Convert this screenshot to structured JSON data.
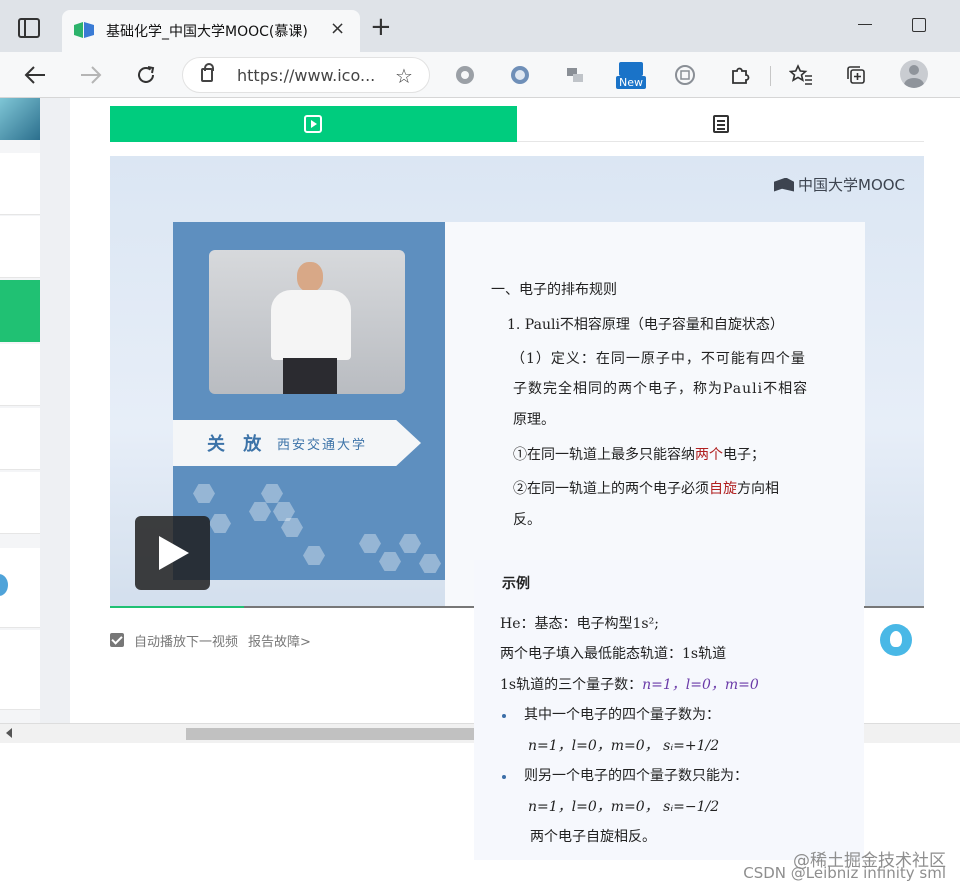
{
  "browser": {
    "tab_title": "基础化学_中国大学MOOC(慕课)",
    "tab_close": "×",
    "new_tab": "+",
    "address_text": "https://www.ico...",
    "new_badge": "New"
  },
  "course_page": {
    "video_logo": "中国大学MOOC",
    "lecturer_name": "关 放",
    "lecturer_school": "西安交通大学",
    "slide": {
      "heading": "一、电子的排布规则",
      "principle": "1. Pauli不相容原理（电子容量和自旋状态）",
      "def_line1": "（1）定义：在同一原子中，不可能有四个量",
      "def_line2": "子数完全相同的两个电子，称为Pauli不相容",
      "def_line3": "原理。",
      "point1_pre": "①在同一轨道上最多只能容纳",
      "point1_red": "两个",
      "point1_post": "电子；",
      "point2_pre": "②在同一轨道上的两个电子必须",
      "point2_red": "自旋",
      "point2_post": "方向相",
      "point2_line2": "反。"
    },
    "autoplay_label": "自动播放下一视频",
    "report_link": "报告故障>"
  },
  "progress": {
    "played_fraction": 0.165
  },
  "example_slide": {
    "title": "示例",
    "line1": "He：基态：电子构型1s²;",
    "line2": "两个电子填入最低能态轨道：1s轨道",
    "line3_pre": "1s轨道的三个量子数：",
    "line3_purple": "n=1，l=0，m=0",
    "line4": "其中一个电子的四个量子数为：",
    "line5": "n=1，l=0，m=0，  sᵢ=+1/2",
    "line6": "则另一个电子的四个量子数只能为：",
    "line7": "n=1，l=0，m=0，  sᵢ=−1/2",
    "line8": "两个电子自旋相反。"
  },
  "watermark": {
    "line1": "@稀土掘金技术社区",
    "line2": "CSDN @Leibniz infinity sml"
  },
  "colors": {
    "accent_green": "#00cc7e",
    "lecturer_blue": "#5e8fbf",
    "emphasis_red": "#b02020"
  }
}
